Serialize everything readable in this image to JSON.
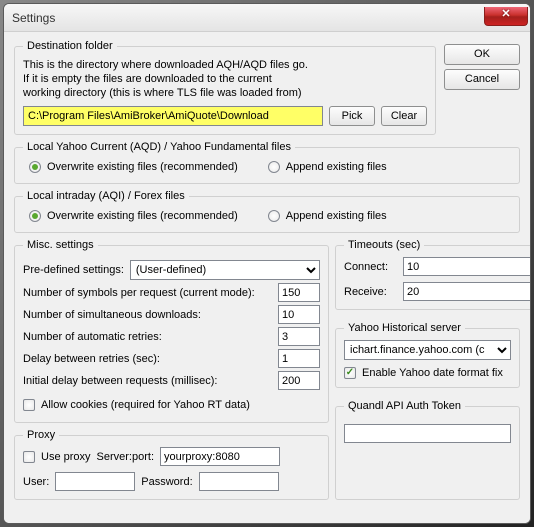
{
  "window": {
    "title": "Settings"
  },
  "buttons": {
    "ok": "OK",
    "cancel": "Cancel",
    "pick": "Pick",
    "clear": "Clear",
    "close_glyph": "✕"
  },
  "dest": {
    "legend": "Destination folder",
    "desc_l1": "This is the directory where downloaded AQH/AQD files go.",
    "desc_l2": "If it is empty the files are downloaded to the current",
    "desc_l3": "working directory (this is where TLS file was loaded from)",
    "path": "C:\\Program Files\\AmiBroker\\AmiQuote\\Download"
  },
  "aqd": {
    "legend": "Local Yahoo Current (AQD) / Yahoo Fundamental files",
    "opt_overwrite": "Overwrite existing files (recommended)",
    "opt_append": "Append existing files",
    "selected": "overwrite"
  },
  "aqi": {
    "legend": "Local intraday (AQI) / Forex files",
    "opt_overwrite": "Overwrite existing files (recommended)",
    "opt_append": "Append existing files",
    "selected": "overwrite"
  },
  "misc": {
    "legend": "Misc. settings",
    "predef_lbl": "Pre-defined settings:",
    "predef_val": "(User-defined)",
    "sym_per_req_lbl": "Number of symbols per request (current mode):",
    "sym_per_req_val": "150",
    "sim_dl_lbl": "Number of simultaneous downloads:",
    "sim_dl_val": "10",
    "retries_lbl": "Number of automatic retries:",
    "retries_val": "3",
    "delay_retries_lbl": "Delay between retries (sec):",
    "delay_retries_val": "1",
    "init_delay_lbl": "Initial delay between requests (millisec):",
    "init_delay_val": "200",
    "allow_cookies_lbl": "Allow cookies (required for Yahoo RT data)"
  },
  "timeouts": {
    "legend": "Timeouts (sec)",
    "connect_lbl": "Connect:",
    "connect_val": "10",
    "receive_lbl": "Receive:",
    "receive_val": "20"
  },
  "yhs": {
    "legend": "Yahoo Historical server",
    "server": "ichart.finance.yahoo.com (c",
    "datefix_lbl": "Enable Yahoo date format fix"
  },
  "quandl": {
    "legend": "Quandl API Auth Token",
    "value": ""
  },
  "proxy": {
    "legend": "Proxy",
    "use_lbl": "Use proxy",
    "serverport_lbl": "Server:port:",
    "serverport_val": "yourproxy:8080",
    "user_lbl": "User:",
    "user_val": "",
    "pass_lbl": "Password:",
    "pass_val": ""
  }
}
